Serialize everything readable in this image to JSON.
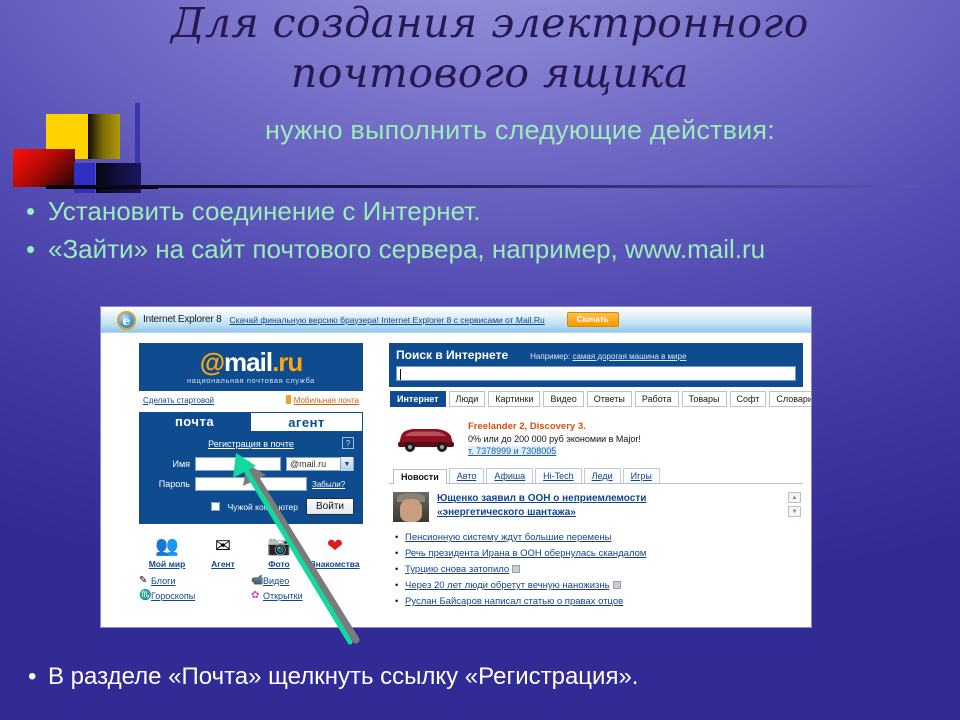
{
  "slide": {
    "title_line1": "Для создания электронного",
    "title_line2": "почтового ящика",
    "subtitle": "нужно выполнить следующие действия:",
    "bullets": [
      "Установить соединение с Интернет.",
      "«Зайти» на сайт почтового сервера, например, www.mail.ru"
    ],
    "bullet_char": "•",
    "final_bullet": "В разделе «Почта» щелкнуть ссылку «Регистрация».",
    "colors": {
      "title": "#231a52",
      "body_text": "#9bedb7",
      "final_text": "#ffffff",
      "background_light": "#9a95dd",
      "background_dark": "#322a95"
    }
  },
  "screenshot": {
    "ie_bar": {
      "logo_glyph": "e",
      "product_name": "Internet Explorer 8",
      "promo_text": "Скачай финальную версию браузера! Internet Explorer 8 с сервисами от Mail.Ru",
      "download_label": "Скачать"
    },
    "mailru": {
      "logo_at": "@",
      "logo_name": "mail",
      "logo_dot_ru": ".ru",
      "logo_tagline": "национальная почтовая служба",
      "make_homepage": "Сделать стартовой",
      "mobile_mail": "Мобильная почта",
      "tabs": [
        {
          "label": "почта",
          "active": true
        },
        {
          "label": "агент",
          "active": false
        }
      ],
      "register_link": "Регистрация в почте",
      "help_glyph": "?",
      "name_label": "Имя",
      "name_value": "",
      "domain_value": "@mail.ru",
      "domain_caret": "▼",
      "password_label": "Пароль",
      "password_value": "",
      "forgot_link": "Забыли?",
      "foreign_pc_label": "Чужой компьютер",
      "login_button": "Войти",
      "services": [
        {
          "caption": "Мой мир",
          "glyph": "👥",
          "icon": "people-icon"
        },
        {
          "caption": "Агент",
          "glyph": "✉",
          "icon": "envelope-icon"
        },
        {
          "caption": "Фото",
          "glyph": "📷",
          "icon": "camera-icon"
        },
        {
          "caption": "Знакомства",
          "glyph": "❤",
          "icon": "heart-icon"
        }
      ],
      "mini_services": [
        {
          "caption": "Блоги",
          "glyph": "✎",
          "icon": "pencil-icon"
        },
        {
          "caption": "Видео",
          "glyph": "📹",
          "icon": "video-icon"
        },
        {
          "caption": "Гороскопы",
          "glyph": "♏",
          "icon": "zodiac-icon"
        },
        {
          "caption": "Открытки",
          "glyph": "✿",
          "icon": "flower-icon"
        }
      ]
    },
    "search": {
      "title": "Поиск в Интернете",
      "hint_prefix": "Например:",
      "hint_link": "самая дорогая машина в мире",
      "query_value": "",
      "tabs": [
        {
          "label": "Интернет",
          "active": true
        },
        {
          "label": "Люди",
          "active": false
        },
        {
          "label": "Картинки",
          "active": false
        },
        {
          "label": "Видео",
          "active": false
        },
        {
          "label": "Ответы",
          "active": false
        },
        {
          "label": "Работа",
          "active": false
        },
        {
          "label": "Товары",
          "active": false
        },
        {
          "label": "Софт",
          "active": false
        },
        {
          "label": "Словари",
          "active": false
        }
      ]
    },
    "ad": {
      "title": "Freelander 2, Discovery 3.",
      "text": "0% или до 200 000 руб экономии в Major!",
      "phone": "т. 7378999 и 7308005"
    },
    "news": {
      "tabs": [
        {
          "label": "Новости",
          "active": true
        },
        {
          "label": "Авто",
          "active": false
        },
        {
          "label": "Афиша",
          "active": false
        },
        {
          "label": "Hi-Tech",
          "active": false
        },
        {
          "label": "Леди",
          "active": false
        },
        {
          "label": "Игры",
          "active": false
        }
      ],
      "lead_line1": "Ющенко заявил в ООН о неприемлемости",
      "lead_line2": "«энергетического шантажа»",
      "scroll_up": "▲",
      "scroll_down": "▼",
      "items": [
        {
          "text": "Пенсионную систему ждут большие перемены",
          "has_icon": false
        },
        {
          "text": "Речь президента Ирана в ООН обернулась скандалом",
          "has_icon": false
        },
        {
          "text": "Турцию снова затопило",
          "has_icon": true
        },
        {
          "text": "Через 20 лет люди обретут вечную наножизнь",
          "has_icon": true
        },
        {
          "text": "Руслан Байсаров написал статью о правах отцов",
          "has_icon": false
        }
      ],
      "bullet_char": "•"
    }
  },
  "annotation": {
    "arrow_color": "#12d9a0",
    "shadow_color": "#7b7b7b",
    "points_to": "Регистрация в почте"
  }
}
